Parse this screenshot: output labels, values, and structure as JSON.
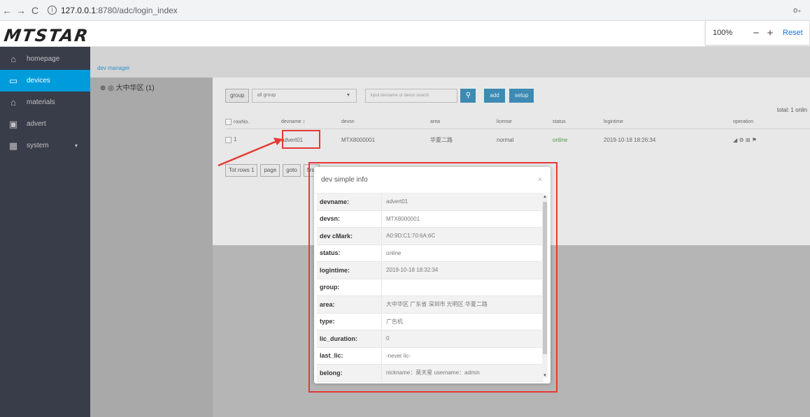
{
  "browser": {
    "url_host": "127.0.0.1",
    "url_path": ":8780/adc/login_index",
    "back": "←",
    "forward": "→",
    "reload": "C",
    "key_icon": "o⁠₊"
  },
  "zoom": {
    "level": "100%",
    "minus": "−",
    "plus": "+",
    "reset": "Reset"
  },
  "logo": "MTSTAR",
  "sidebar": {
    "items": [
      {
        "label": "homepage",
        "icon": "home-icon"
      },
      {
        "label": "devices",
        "icon": "device-icon",
        "active": true
      },
      {
        "label": "materials",
        "icon": "materials-icon"
      },
      {
        "label": "advert",
        "icon": "advert-icon"
      },
      {
        "label": "system",
        "icon": "system-icon",
        "caret": "▾"
      }
    ]
  },
  "breadcrumb": "dev manager",
  "tree": {
    "root": "⊕ ◎ 大中华区 (1)"
  },
  "filter": {
    "group_label": "group",
    "group_select": "all group",
    "search_placeholder": "input devname or devsn search",
    "search_icon": "magnifier-icon",
    "add_label": "add",
    "setup_label": "setup"
  },
  "total": "total: 1  onlin",
  "table": {
    "columns": [
      "rowNo.",
      "devname ↕",
      "devsn",
      "area",
      "license",
      "status",
      "logintime",
      "operation"
    ],
    "rows": [
      {
        "no": "1",
        "devname": "advert01",
        "devsn": "MTX8000001",
        "area": "华夏二路",
        "license": "normal",
        "status": "online",
        "logintime": "2019-10-18 18:26:34",
        "ops": "◢ ⚙ ⊞ ⚑"
      }
    ]
  },
  "pager": {
    "total_rows": "Tot rows 1",
    "page": "page",
    "goto": "goto",
    "first": "first"
  },
  "modal": {
    "title": "dev simple info",
    "close": "×",
    "rows": [
      {
        "k": "devname:",
        "v": "advert01"
      },
      {
        "k": "devsn:",
        "v": "MTX8000001"
      },
      {
        "k": "dev cMark:",
        "v": "A0:9D:C1:70:6A:6C"
      },
      {
        "k": "status:",
        "v": "online"
      },
      {
        "k": "logintime:",
        "v": "2019-10-18 18:32:34"
      },
      {
        "k": "group:",
        "v": ""
      },
      {
        "k": "area:",
        "v": "大中华区 广东省 深圳市 光明区 华夏二路"
      },
      {
        "k": "type:",
        "v": "广告机"
      },
      {
        "k": "lic_duration:",
        "v": "0"
      },
      {
        "k": "last_lic:",
        "v": "-never lic-"
      },
      {
        "k": "belong:",
        "v": "nickname：莫天星  username：admin"
      }
    ]
  },
  "colors": {
    "sidebar": "#393d49",
    "active": "#009bdb",
    "accent": "#3d8ab3",
    "highlight": "#e53935"
  }
}
